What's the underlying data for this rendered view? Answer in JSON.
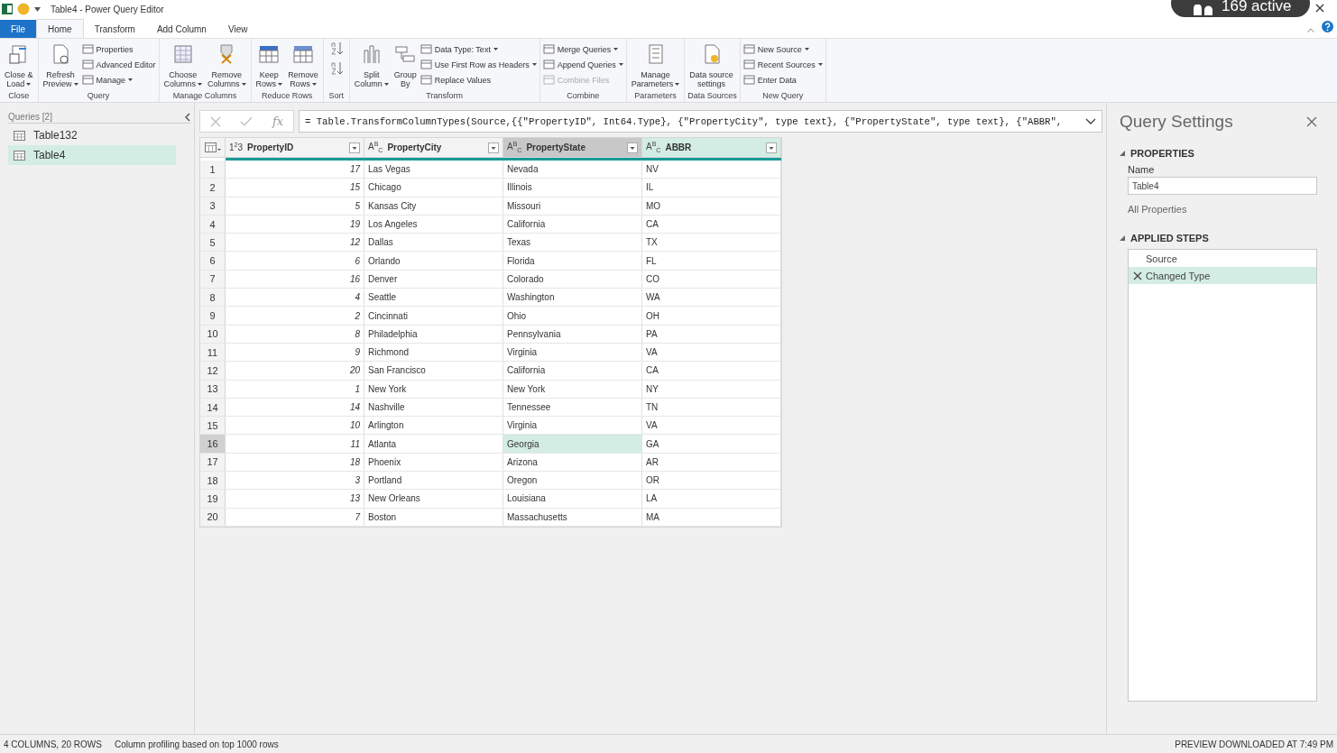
{
  "window": {
    "title": "Table4 - Power Query Editor",
    "badge": "169 active"
  },
  "file_tab": "File",
  "tabs": [
    {
      "label": "Home",
      "selected": true
    },
    {
      "label": "Transform",
      "selected": false
    },
    {
      "label": "Add Column",
      "selected": false
    },
    {
      "label": "View",
      "selected": false
    }
  ],
  "ribbon": [
    {
      "label": "Close",
      "items": [
        {
          "kind": "large",
          "lines": [
            "Close &",
            "Load"
          ],
          "dropdown": true
        }
      ]
    },
    {
      "label": "Query",
      "items": [
        {
          "kind": "large",
          "lines": [
            "Refresh",
            "Preview"
          ],
          "dropdown": true
        },
        {
          "kind": "stack",
          "rows": [
            {
              "label": "Properties",
              "dropdown": false,
              "disabled": false
            },
            {
              "label": "Advanced Editor",
              "dropdown": false,
              "disabled": false
            },
            {
              "label": "Manage",
              "dropdown": true,
              "disabled": false
            }
          ]
        }
      ]
    },
    {
      "label": "Manage Columns",
      "items": [
        {
          "kind": "large",
          "lines": [
            "Choose",
            "Columns"
          ],
          "dropdown": true
        },
        {
          "kind": "large",
          "lines": [
            "Remove",
            "Columns"
          ],
          "dropdown": true
        }
      ]
    },
    {
      "label": "Reduce Rows",
      "items": [
        {
          "kind": "large",
          "lines": [
            "Keep",
            "Rows"
          ],
          "dropdown": true
        },
        {
          "kind": "large",
          "lines": [
            "Remove",
            "Rows"
          ],
          "dropdown": true
        }
      ]
    },
    {
      "label": "Sort",
      "items": [
        {
          "kind": "sort"
        }
      ]
    },
    {
      "label": "Transform",
      "items": [
        {
          "kind": "large",
          "lines": [
            "Split",
            "Column"
          ],
          "dropdown": true
        },
        {
          "kind": "large",
          "lines": [
            "Group",
            "By"
          ],
          "dropdown": false
        },
        {
          "kind": "stack",
          "rows": [
            {
              "label": "Data Type: Text",
              "dropdown": true,
              "disabled": false
            },
            {
              "label": "Use First Row as Headers",
              "dropdown": true,
              "disabled": false
            },
            {
              "label": "Replace Values",
              "dropdown": false,
              "disabled": false
            }
          ]
        }
      ]
    },
    {
      "label": "Combine",
      "items": [
        {
          "kind": "stack",
          "rows": [
            {
              "label": "Merge Queries",
              "dropdown": true,
              "disabled": false
            },
            {
              "label": "Append Queries",
              "dropdown": true,
              "disabled": false
            },
            {
              "label": "Combine Files",
              "dropdown": false,
              "disabled": true
            }
          ]
        }
      ]
    },
    {
      "label": "Parameters",
      "items": [
        {
          "kind": "large",
          "lines": [
            "Manage",
            "Parameters"
          ],
          "dropdown": true
        }
      ]
    },
    {
      "label": "Data Sources",
      "items": [
        {
          "kind": "large",
          "lines": [
            "Data source",
            "settings"
          ],
          "dropdown": false
        }
      ]
    },
    {
      "label": "New Query",
      "items": [
        {
          "kind": "stack",
          "rows": [
            {
              "label": "New Source",
              "dropdown": true,
              "disabled": false
            },
            {
              "label": "Recent Sources",
              "dropdown": true,
              "disabled": false
            },
            {
              "label": "Enter Data",
              "dropdown": false,
              "disabled": false
            }
          ]
        }
      ]
    }
  ],
  "queries": {
    "header": "Queries [2]",
    "items": [
      {
        "label": "Table132",
        "selected": false
      },
      {
        "label": "Table4",
        "selected": true
      }
    ]
  },
  "formula_bar": {
    "function_label": "fx",
    "formula": "= Table.TransformColumnTypes(Source,{{\"PropertyID\", Int64.Type}, {\"PropertyCity\", type text}, {\"PropertyState\", type text}, {\"ABBR\","
  },
  "table": {
    "columns": [
      {
        "name": "PropertyID",
        "type_badge": "1$^{2}$3",
        "kind": "number",
        "selected": false,
        "active": false
      },
      {
        "name": "PropertyCity",
        "type_badge": "A$^{B}$$_{C}$",
        "kind": "text",
        "selected": false,
        "active": false
      },
      {
        "name": "PropertyState",
        "type_badge": "A$^{B}$$_{C}$",
        "kind": "text",
        "selected": false,
        "active": true
      },
      {
        "name": "ABBR",
        "type_badge": "A$^{B}$$_{C}$",
        "kind": "text",
        "selected": true,
        "active": false
      }
    ],
    "rows": [
      {
        "number": "1",
        "cells": [
          "17",
          "Las Vegas",
          "Nevada",
          "NV"
        ],
        "selected": false
      },
      {
        "number": "2",
        "cells": [
          "15",
          "Chicago",
          "Illinois",
          "IL"
        ],
        "selected": false
      },
      {
        "number": "3",
        "cells": [
          "5",
          "Kansas City",
          "Missouri",
          "MO"
        ],
        "selected": false
      },
      {
        "number": "4",
        "cells": [
          "19",
          "Los Angeles",
          "California",
          "CA"
        ],
        "selected": false
      },
      {
        "number": "5",
        "cells": [
          "12",
          "Dallas",
          "Texas",
          "TX"
        ],
        "selected": false
      },
      {
        "number": "6",
        "cells": [
          "6",
          "Orlando",
          "Florida",
          "FL"
        ],
        "selected": false
      },
      {
        "number": "7",
        "cells": [
          "16",
          "Denver",
          "Colorado",
          "CO"
        ],
        "selected": false
      },
      {
        "number": "8",
        "cells": [
          "4",
          "Seattle",
          "Washington",
          "WA"
        ],
        "selected": false
      },
      {
        "number": "9",
        "cells": [
          "2",
          "Cincinnati",
          "Ohio",
          "OH"
        ],
        "selected": false
      },
      {
        "number": "10",
        "cells": [
          "8",
          "Philadelphia",
          "Pennsylvania",
          "PA"
        ],
        "selected": false
      },
      {
        "number": "11",
        "cells": [
          "9",
          "Richmond",
          "Virginia",
          "VA"
        ],
        "selected": false
      },
      {
        "number": "12",
        "cells": [
          "20",
          "San Francisco",
          "California",
          "CA"
        ],
        "selected": false
      },
      {
        "number": "13",
        "cells": [
          "1",
          "New York",
          "New York",
          "NY"
        ],
        "selected": false
      },
      {
        "number": "14",
        "cells": [
          "14",
          "Nashville",
          "Tennessee",
          "TN"
        ],
        "selected": false
      },
      {
        "number": "15",
        "cells": [
          "10",
          "Arlington",
          "Virginia",
          "VA"
        ],
        "selected": false
      },
      {
        "number": "16",
        "cells": [
          "11",
          "Atlanta",
          "Georgia",
          "GA"
        ],
        "selected": true
      },
      {
        "number": "17",
        "cells": [
          "18",
          "Phoenix",
          "Arizona",
          "AR"
        ],
        "selected": false
      },
      {
        "number": "18",
        "cells": [
          "3",
          "Portland",
          "Oregon",
          "OR"
        ],
        "selected": false
      },
      {
        "number": "19",
        "cells": [
          "13",
          "New Orleans",
          "Louisiana",
          "LA"
        ],
        "selected": false
      },
      {
        "number": "20",
        "cells": [
          "7",
          "Boston",
          "Massachusetts",
          "MA"
        ],
        "selected": false
      }
    ]
  },
  "query_settings": {
    "title": "Query Settings",
    "properties_heading": "PROPERTIES",
    "name_label": "Name",
    "name_value": "Table4",
    "all_properties": "All Properties",
    "steps_heading": "APPLIED STEPS",
    "steps": [
      {
        "label": "Source",
        "selected": false
      },
      {
        "label": "Changed Type",
        "selected": true
      }
    ]
  },
  "status_bar": {
    "summary": "4 COLUMNS, 20 ROWS",
    "profiling": "Column profiling based on top 1000 rows",
    "preview": "PREVIEW DOWNLOADED AT 7:49 PM"
  }
}
